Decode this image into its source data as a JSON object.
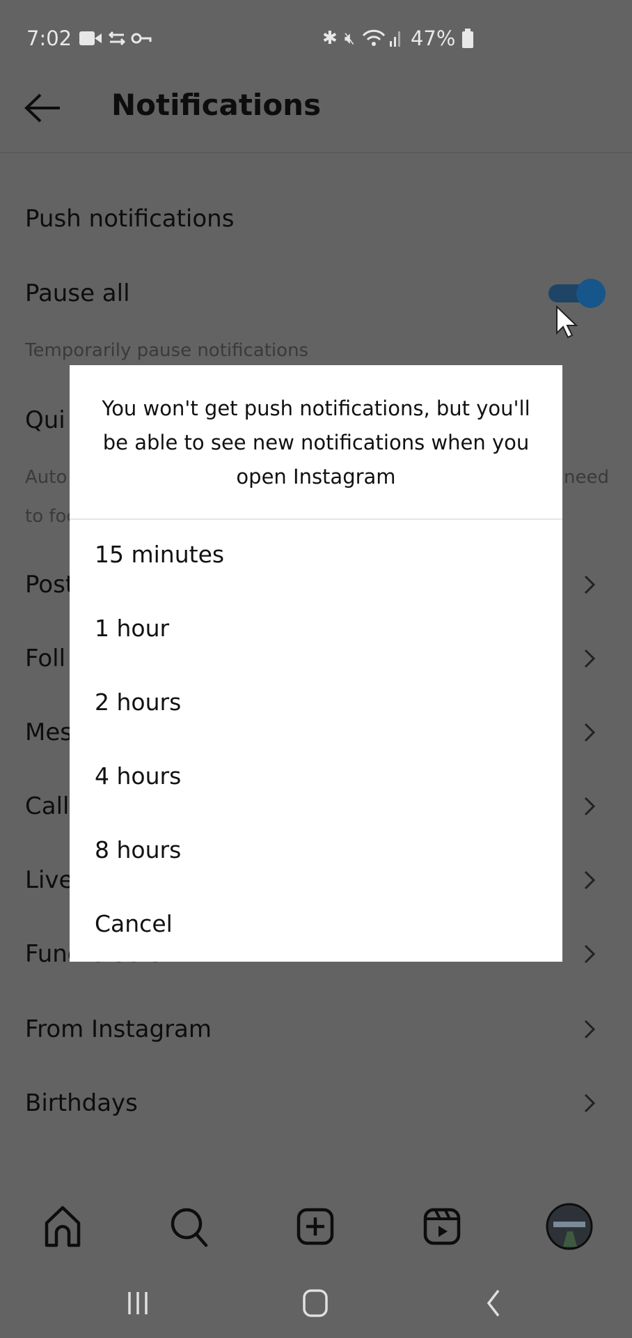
{
  "status_bar": {
    "time": "7:02",
    "battery": "47%",
    "left_icons": [
      "video-icon",
      "sync-icon",
      "key-icon"
    ],
    "right_icons": [
      "bluetooth-icon",
      "mute-icon",
      "wifi-icon",
      "signal-icon",
      "battery-icon"
    ]
  },
  "header": {
    "title": "Notifications",
    "back_icon": "arrow-left-icon"
  },
  "settings": {
    "section": "Push notifications",
    "pause_all": {
      "label": "Pause all",
      "description": "Temporarily pause notifications",
      "toggle_on": true,
      "toggle_color": "#16568a"
    },
    "quiet_mode": {
      "label": "Qui",
      "description_line1": "Auto",
      "description_right": "need",
      "description_line2": "to foc"
    },
    "items": [
      {
        "label": "Post"
      },
      {
        "label": "Foll"
      },
      {
        "label": "Mes"
      },
      {
        "label": "Call"
      },
      {
        "label": "Live"
      },
      {
        "label": "Fundraisers"
      },
      {
        "label": "From Instagram"
      },
      {
        "label": "Birthdays"
      }
    ]
  },
  "dialog": {
    "message": "You won't get push notifications, but you'll be able to see new notifications when you open Instagram",
    "options": [
      "15 minutes",
      "1 hour",
      "2 hours",
      "4 hours",
      "8 hours",
      "Cancel"
    ]
  },
  "bottom_nav": [
    "home-icon",
    "search-icon",
    "create-icon",
    "reels-icon",
    "profile-avatar"
  ],
  "system_nav": [
    "recents-icon",
    "home-button-icon",
    "back-icon"
  ]
}
